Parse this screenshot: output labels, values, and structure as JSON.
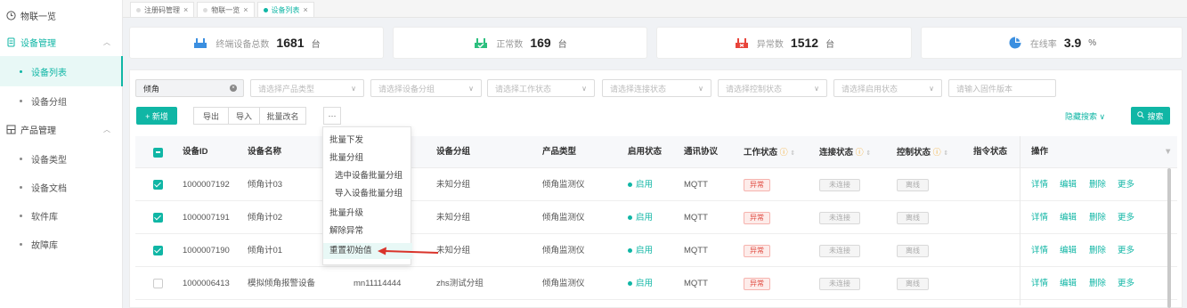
{
  "sidebar": {
    "items": [
      {
        "label": "物联一览",
        "icon": "clock-icon",
        "type": "top"
      },
      {
        "label": "设备管理",
        "icon": "device-icon",
        "type": "group",
        "active": true
      },
      {
        "label": "设备列表",
        "type": "sub",
        "active": true
      },
      {
        "label": "设备分组",
        "type": "sub"
      },
      {
        "label": "产品管理",
        "icon": "grid-icon",
        "type": "group"
      },
      {
        "label": "设备类型",
        "type": "sub"
      },
      {
        "label": "设备文档",
        "type": "sub"
      },
      {
        "label": "软件库",
        "type": "sub"
      },
      {
        "label": "故障库",
        "type": "sub"
      }
    ]
  },
  "tabs": [
    {
      "label": "注册码管理",
      "close": "×"
    },
    {
      "label": "物联一览",
      "close": "×"
    },
    {
      "label": "设备列表",
      "close": "×",
      "active": true
    }
  ],
  "stats": [
    {
      "label": "终端设备总数",
      "value": "1681",
      "unit": "台",
      "icon": "terminal-device-icon",
      "color": "#3b8fe0"
    },
    {
      "label": "正常数",
      "value": "169",
      "unit": "台",
      "icon": "normal-device-icon",
      "color": "#2cbf7e"
    },
    {
      "label": "异常数",
      "value": "1512",
      "unit": "台",
      "icon": "abnormal-device-icon",
      "color": "#e8443a"
    },
    {
      "label": "在线率",
      "value": "3.9",
      "unit": "%",
      "icon": "pie-chart-icon",
      "color": "#3b8fe0"
    }
  ],
  "filters": {
    "keyword": "倾角",
    "product_type": "请选择产品类型",
    "device_group": "请选择设备分组",
    "work_status": "请选择工作状态",
    "connect_status": "请选择连接状态",
    "control_status": "请选择控制状态",
    "enable_status": "请选择启用状态",
    "firmware_placeholder": "请输入固件版本"
  },
  "toolbar": {
    "add": "+ 新增",
    "export": "导出",
    "import": "导入",
    "batch_rename": "批量改名",
    "more": "···",
    "hide_search": "隐藏搜索 ∨",
    "search": "搜索"
  },
  "table": {
    "headers": {
      "device_id": "设备ID",
      "device_name": "设备名称",
      "device_group": "设备分组",
      "product_type": "产品类型",
      "enable_status": "启用状态",
      "protocol": "通讯协议",
      "work_status": "工作状态",
      "connect_status": "连接状态",
      "control_status": "控制状态",
      "command_status": "指令状态",
      "actions": "操作"
    },
    "rows": [
      {
        "id": "1000007192",
        "name": "倾角计03",
        "serial": "",
        "group": "未知分组",
        "product": "倾角监测仪",
        "enabled": "启用",
        "protocol": "MQTT",
        "work": "异常",
        "connect": "未连接",
        "control": "离线",
        "checked": true
      },
      {
        "id": "1000007191",
        "name": "倾角计02",
        "serial": "",
        "group": "未知分组",
        "product": "倾角监测仪",
        "enabled": "启用",
        "protocol": "MQTT",
        "work": "异常",
        "connect": "未连接",
        "control": "离线",
        "checked": true
      },
      {
        "id": "1000007190",
        "name": "倾角计01",
        "serial": "",
        "group": "未知分组",
        "product": "倾角监测仪",
        "enabled": "启用",
        "protocol": "MQTT",
        "work": "异常",
        "connect": "未连接",
        "control": "离线",
        "checked": true
      },
      {
        "id": "1000006413",
        "name": "模拟倾角报警设备",
        "serial": "mn11114444",
        "group": "zhs测试分组",
        "product": "倾角监测仪",
        "enabled": "启用",
        "protocol": "MQTT",
        "work": "异常",
        "connect": "未连接",
        "control": "离线",
        "checked": false
      }
    ],
    "row_actions": {
      "detail": "详情",
      "edit": "编辑",
      "delete": "删除",
      "more": "更多"
    }
  },
  "more_menu": [
    {
      "label": "批量下发",
      "level": 0
    },
    {
      "label": "批量分组",
      "level": 0
    },
    {
      "label": "选中设备批量分组",
      "level": 1
    },
    {
      "label": "导入设备批量分组",
      "level": 1
    },
    {
      "label": "批量升级",
      "level": 0
    },
    {
      "label": "解除异常",
      "level": 0
    },
    {
      "label": "重置初始值",
      "level": 0,
      "highlighted": true
    }
  ],
  "colors": {
    "accent": "#10b6a5",
    "danger": "#e0483e",
    "annotation_arrow": "#d9342b"
  }
}
